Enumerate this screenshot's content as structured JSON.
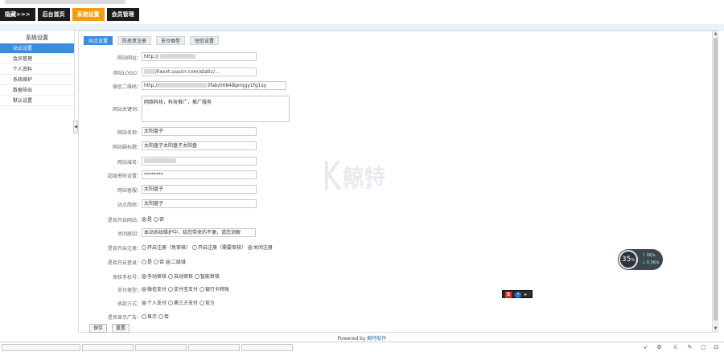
{
  "topnav": {
    "items": [
      {
        "label": "隐藏>>>",
        "active": false
      },
      {
        "label": "后台首页",
        "active": false
      },
      {
        "label": "系统设置",
        "active": true
      },
      {
        "label": "会员管理",
        "active": false
      }
    ]
  },
  "sidebar": {
    "title": "系统设置",
    "items": [
      {
        "label": "站点设置",
        "active": true
      },
      {
        "label": "会员管理",
        "active": false
      },
      {
        "label": "个人资料",
        "active": false
      },
      {
        "label": "系统维护",
        "active": false
      },
      {
        "label": "数据导出",
        "active": false
      },
      {
        "label": "默认设置",
        "active": false
      }
    ]
  },
  "tabs": [
    {
      "label": "站点设置",
      "active": true
    },
    {
      "label": "防恶意注册",
      "active": false
    },
    {
      "label": "支付类型",
      "active": false
    },
    {
      "label": "短信设置",
      "active": false
    }
  ],
  "form": {
    "site_url": {
      "label": "网站网址：",
      "value": "http://"
    },
    "logo": {
      "label": "网站LOGO：",
      "value": "/lixxxt.uuucn.com/static/..."
    },
    "qrcode": {
      "label": "微信二维码：",
      "value": "http://",
      "value_suffix": "3fab/0084Bpmjgy1fg1sy"
    },
    "keywords": {
      "label": "网站关键词：",
      "value": "网络科技，科技推广，推广服务"
    },
    "site_name": {
      "label": "网站名称：",
      "value": "太阳盘子"
    },
    "site_title": {
      "label": "网站副标题：",
      "value": "太阳盘子太阳盘子太阳盘"
    },
    "domain": {
      "label": "网站域名：",
      "value": ""
    },
    "password": {
      "label": "超级密码设置：",
      "value": "********"
    },
    "contact": {
      "label": "网站客服：",
      "value": "太阳盘子"
    },
    "short_name": {
      "label": "站点简称：",
      "value": "太阳盘子"
    },
    "open_site": {
      "label": "是否开启网站：",
      "options": [
        {
          "label": "是",
          "on": true
        },
        {
          "label": "否",
          "on": false
        }
      ]
    },
    "close_msg": {
      "label": "关闭原因：",
      "value": "本站系统维护中，给您带来的不便，请您谅解"
    },
    "reg_mode": {
      "label": "是否开启注册：",
      "options": [
        {
          "label": "开启注册（免审核）",
          "on": true
        },
        {
          "label": "开启注册（需要审核）",
          "on": false
        },
        {
          "label": "关闭注册",
          "on": false
        }
      ]
    },
    "login_mode": {
      "label": "是否开启登录：",
      "options": [
        {
          "label": "是",
          "on": false
        },
        {
          "label": "否",
          "on": false
        },
        {
          "label": "二级域",
          "on": false
        }
      ]
    },
    "audit_mode": {
      "label": "审核手机号：",
      "options": [
        {
          "label": "手动审核",
          "on": true
        },
        {
          "label": "自动审核",
          "on": false
        },
        {
          "label": "智能审核",
          "on": false
        }
      ]
    },
    "pay_type": {
      "label": "支付类型：",
      "options": [
        {
          "label": "微信支付",
          "on": true
        },
        {
          "label": "支付宝支付",
          "on": false
        },
        {
          "label": "银行卡转账",
          "on": false
        }
      ]
    },
    "pay_mode": {
      "label": "收款方式：",
      "options": [
        {
          "label": "个人支付",
          "on": true
        },
        {
          "label": "第三方支付",
          "on": false
        },
        {
          "label": "官方",
          "on": false
        }
      ]
    },
    "show_ads": {
      "label": "是否显示广告：",
      "options": [
        {
          "label": "显示",
          "on": false
        },
        {
          "label": "否",
          "on": false
        }
      ]
    }
  },
  "buttons": {
    "save": "保存",
    "reset": "重置"
  },
  "watermark": {
    "text": "鲸特",
    "sub": "KHTD"
  },
  "widget": {
    "value": "35",
    "unit": "%",
    "up": "0K/s",
    "down": "0.3K/s"
  },
  "footer": {
    "prefix": "Powered by",
    "link": "鲸特软件"
  }
}
